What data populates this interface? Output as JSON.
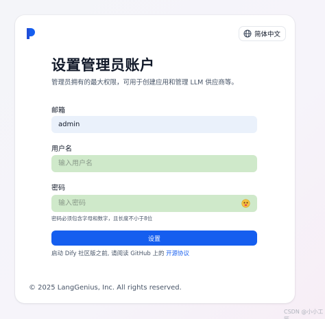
{
  "header": {
    "logo_icon": "dify-logo-icon",
    "language_label": "简体中文",
    "language_icon": "globe-icon"
  },
  "page": {
    "title": "设置管理员账户",
    "subtitle": "管理员拥有的最大权限，可用于创建应用和管理 LLM 供应商等。"
  },
  "form": {
    "email_label": "邮箱",
    "email_value": "admin",
    "username_label": "用户名",
    "username_placeholder": "输入用户名",
    "password_label": "密码",
    "password_placeholder": "输入密码",
    "password_hint": "密码必须包含字母和数字，且长度不小于8位",
    "submit_label": "设置"
  },
  "agreement": {
    "text": "启动 Dify 社区版之前, 请阅读 GitHub 上的 ",
    "link_label": "开源协议"
  },
  "footer": {
    "copyright": "© 2025 LangGenius, Inc. All rights reserved."
  },
  "watermark": "CSDN @小小工匠",
  "colors": {
    "primary": "#155eef",
    "field_filled": "#eaf1fb",
    "field_highlight": "#cfe9ca"
  }
}
